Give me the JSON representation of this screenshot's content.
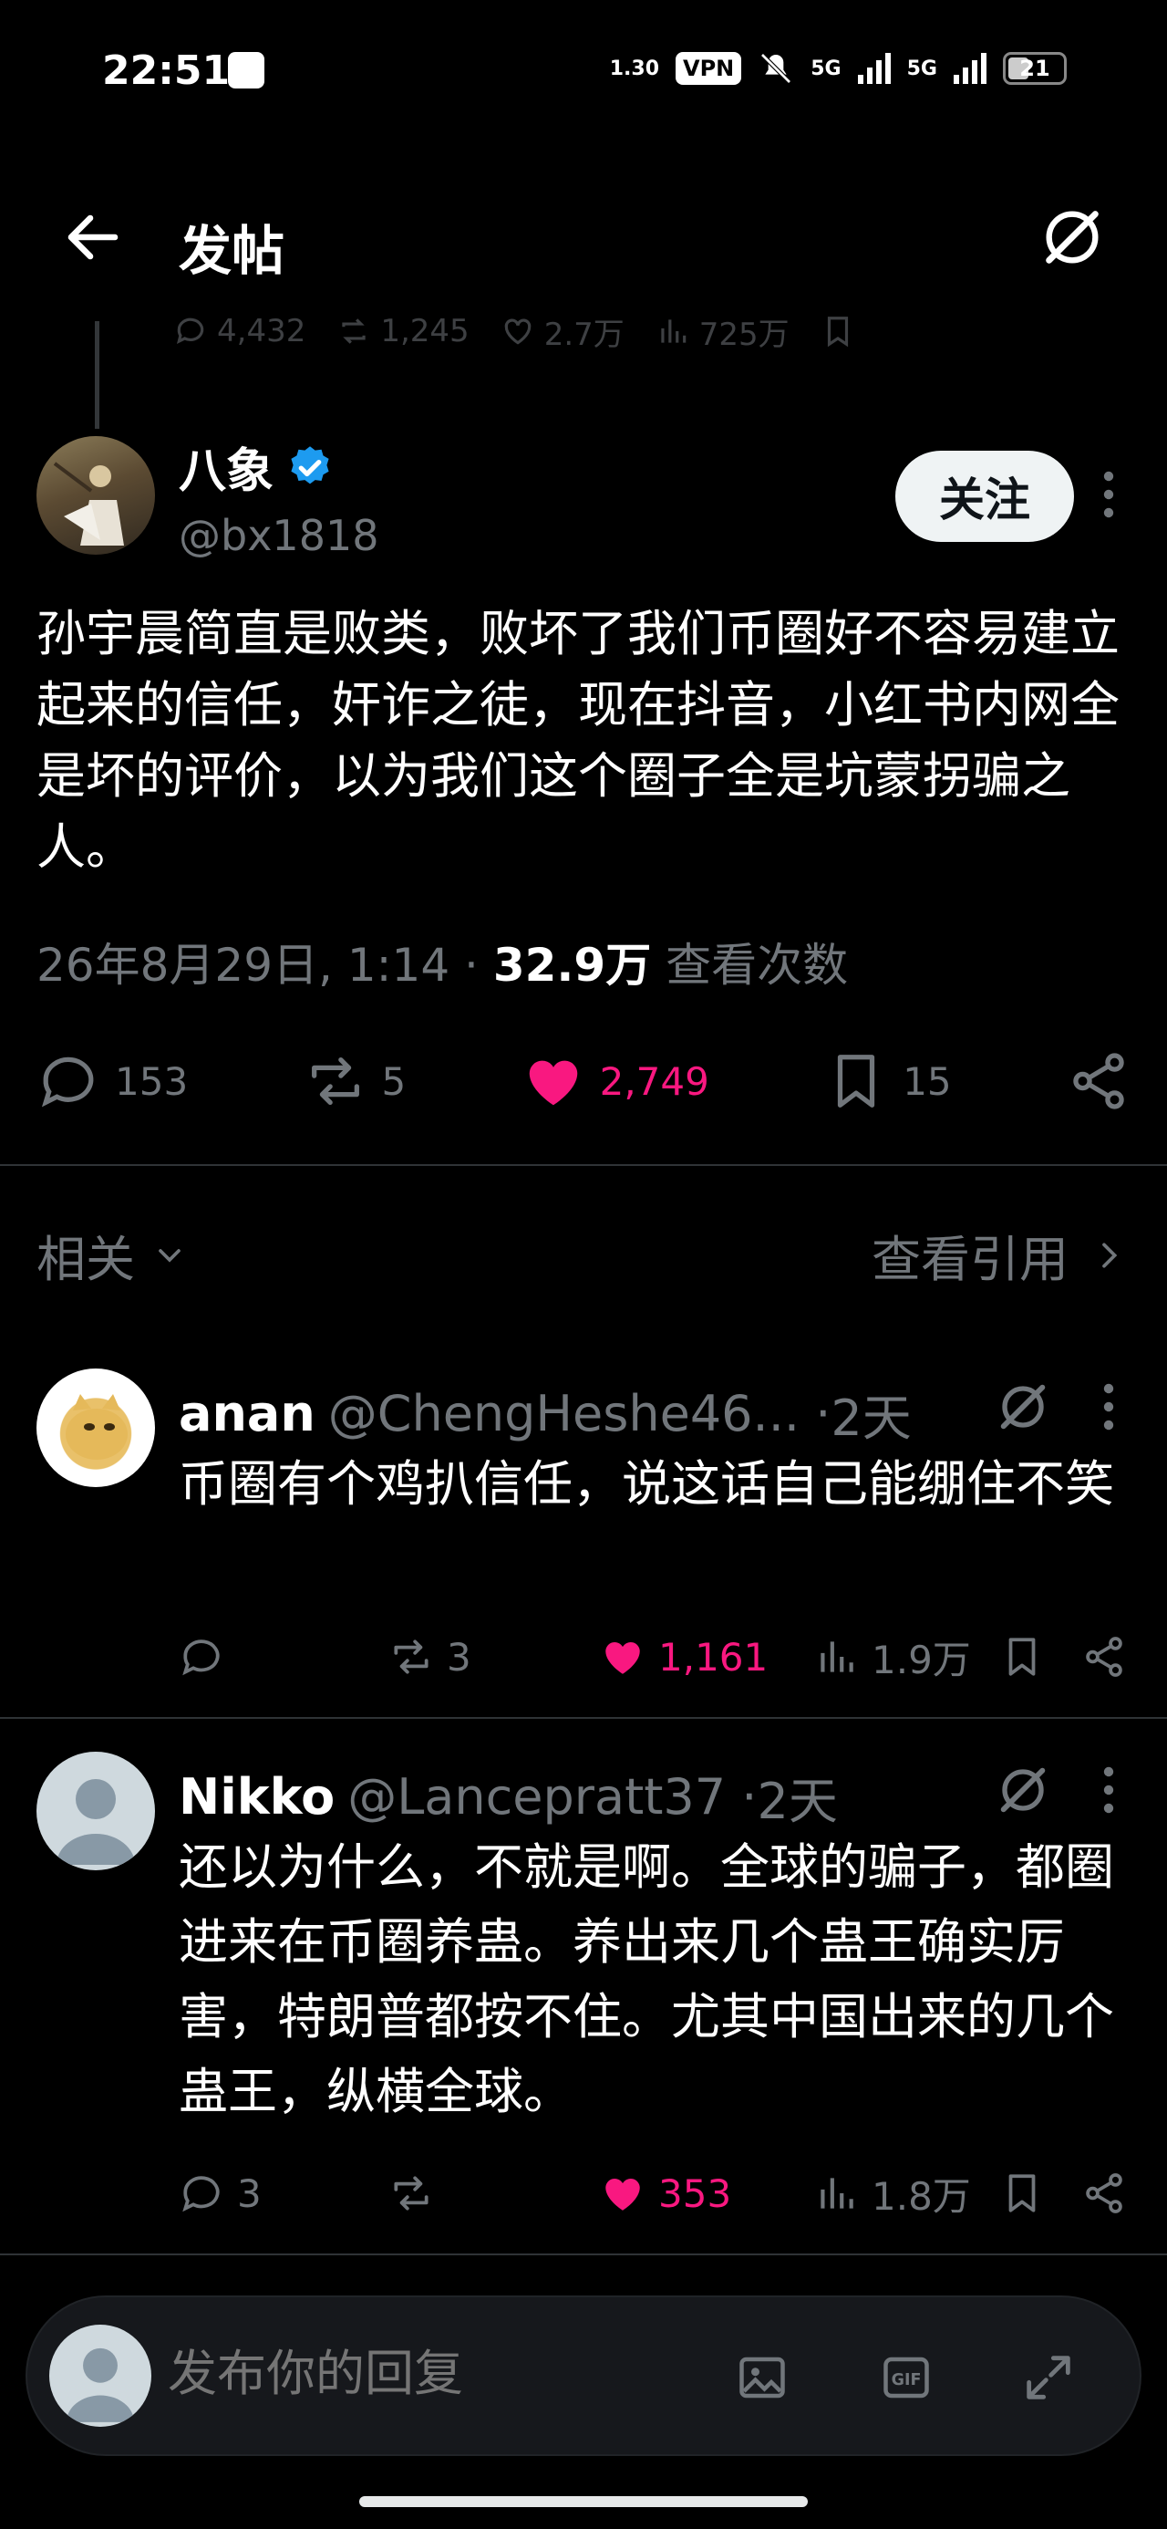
{
  "status_bar": {
    "time": "22:51",
    "speed_value": "1.30",
    "vpn": "VPN",
    "net1": "5G",
    "net2": "5G",
    "battery": "21"
  },
  "header": {
    "title": "发帖"
  },
  "prev_stats": {
    "replies": "4,432",
    "reposts": "1,245",
    "likes": "2.7万",
    "views": "725万"
  },
  "post": {
    "author_name": "八象",
    "author_handle": "@bx1818",
    "follow_label": "关注",
    "text": "孙宇晨简直是败类，败坏了我们币圈好不容易建立起来的信任，奸诈之徒，现在抖音，小红书内网全是坏的评价，以为我们这个圈子全是坑蒙拐骗之人。",
    "date": "26年8月29日, 1:14",
    "view_count": "32.9万",
    "view_label": "查看次数",
    "replies": "153",
    "reposts": "5",
    "likes": "2,749",
    "bookmarks": "15",
    "verified": true
  },
  "related": {
    "left_label": "相关",
    "right_label": "查看引用"
  },
  "replies": [
    {
      "name": "anan",
      "handle": "@ChengHeshe46...",
      "time": "2天",
      "text": "币圈有个鸡扒信任，说这话自己能绷住不笑",
      "replies": "",
      "reposts": "3",
      "likes": "1,161",
      "views": "1.9万"
    },
    {
      "name": "Nikko",
      "handle": "@Lancepratt37",
      "time": "2天",
      "text": "还以为什么，不就是啊。全球的骗子，都圈进来在币圈养蛊。养出来几个蛊王确实厉害，特朗普都按不住。尤其中国出来的几个蛊王，纵横全球。",
      "replies": "3",
      "reposts": "",
      "likes": "353",
      "views": "1.8万"
    }
  ],
  "composer": {
    "placeholder": "发布你的回复",
    "gif_label": "GIF"
  },
  "colors": {
    "like": "#f91880",
    "verified": "#1d9bf0",
    "muted": "#71767b"
  }
}
